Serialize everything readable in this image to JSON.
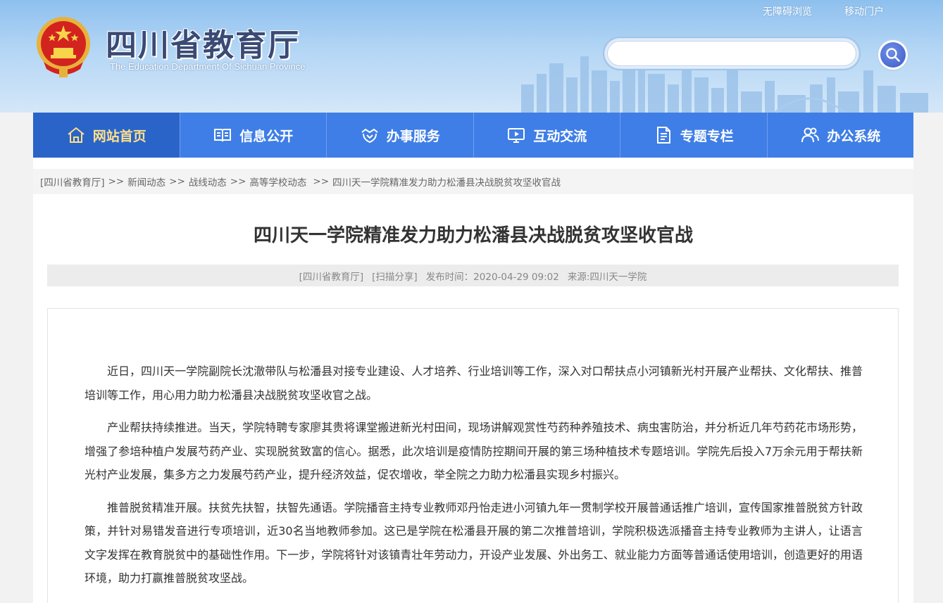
{
  "site": {
    "title": "四川省教育厅",
    "subtitle": "The Education Department Of Sichuan Province"
  },
  "top_links": {
    "accessibility": "无障碍浏览",
    "mobile": "移动门户"
  },
  "search": {
    "placeholder": ""
  },
  "nav": {
    "items": [
      {
        "label": "网站首页",
        "icon": "home-icon"
      },
      {
        "label": "信息公开",
        "icon": "book-icon"
      },
      {
        "label": "办事服务",
        "icon": "handshake-icon"
      },
      {
        "label": "互动交流",
        "icon": "monitor-icon"
      },
      {
        "label": "专题专栏",
        "icon": "document-icon"
      },
      {
        "label": "办公系统",
        "icon": "users-icon"
      }
    ],
    "active_index": 0
  },
  "breadcrumb": {
    "items": [
      "[四川省教育厅]",
      "新闻动态",
      "战线动态",
      "高等学校动态",
      "四川天一学院精准发力助力松潘县决战脱贫攻坚收官战"
    ],
    "separator": ">>"
  },
  "article": {
    "title": "四川天一学院精准发力助力松潘县决战脱贫攻坚收官战",
    "meta": {
      "source_tag": "[四川省教育厅]",
      "share": "[扫描分享]",
      "publish": "发布时间：2020-04-29 09:02",
      "origin": "来源:四川天一学院"
    },
    "paragraphs": [
      "近日，四川天一学院副院长沈澈带队与松潘县对接专业建设、人才培养、行业培训等工作，深入对口帮扶点小河镇新光村开展产业帮扶、文化帮扶、推普培训等工作，用心用力助力松潘县决战脱贫攻坚收官之战。",
      "产业帮扶持续推进。当天，学院特聘专家廖其贵将课堂搬进新光村田间，现场讲解观赏性芍药种养殖技术、病虫害防治，并分析近几年芍药花市场形势，增强了参培种植户发展芍药产业、实现脱贫致富的信心。据悉，此次培训是疫情防控期间开展的第三场种植技术专题培训。学院先后投入7万余元用于帮扶新光村产业发展，集多方之力发展芍药产业，提升经济效益，促农增收，举全院之力助力松潘县实现乡村振兴。",
      "推普脱贫精准开展。扶贫先扶智，扶智先通语。学院播音主持专业教师邓丹怡走进小河镇九年一贯制学校开展普通话推广培训，宣传国家推普脱贫方针政策，并针对易错发音进行专项培训，近30名当地教师参加。这已是学院在松潘县开展的第二次推普培训，学院积极选派播音主持专业教师为主讲人，让语言文字发挥在教育脱贫中的基础性作用。下一步，学院将针对该镇青壮年劳动力，开设产业发展、外出务工、就业能力方面等普通话使用培训，创造更好的用语环境，助力打赢推普脱贫攻坚战。"
    ]
  },
  "colors": {
    "nav_bg": "#3f7ee6",
    "nav_active_bg": "#2a64c8",
    "nav_active_text": "#ffe08a",
    "title_color": "#3a4a74"
  }
}
